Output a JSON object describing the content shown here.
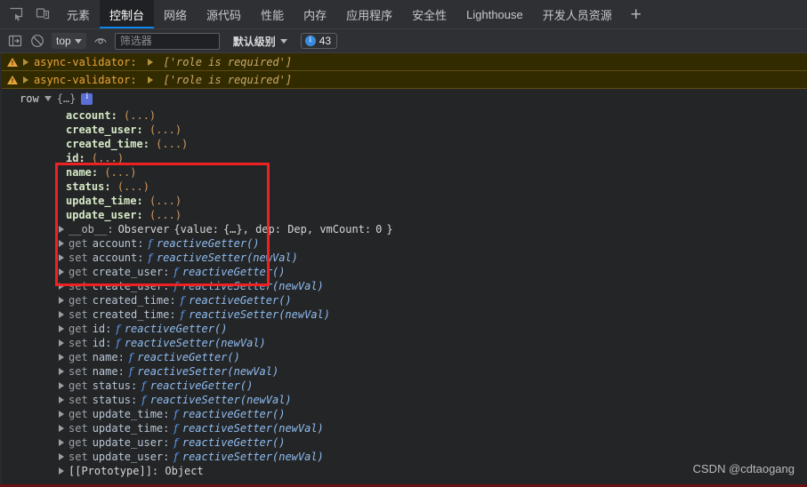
{
  "window": {
    "app": "Chrome DevTools",
    "watermark": "CSDN @cdtaogang"
  },
  "tabbar": {
    "icons": [
      {
        "name": "inspect-element-icon",
        "label": "检查元素"
      },
      {
        "name": "device-toolbar-icon",
        "label": "切换设备工具栏"
      }
    ],
    "tabs": [
      {
        "label": "元素",
        "active": false
      },
      {
        "label": "控制台",
        "active": true
      },
      {
        "label": "网络",
        "active": false
      },
      {
        "label": "源代码",
        "active": false
      },
      {
        "label": "性能",
        "active": false
      },
      {
        "label": "内存",
        "active": false
      },
      {
        "label": "应用程序",
        "active": false
      },
      {
        "label": "安全性",
        "active": false
      },
      {
        "label": "Lighthouse",
        "active": false
      },
      {
        "label": "开发人员资源",
        "active": false
      }
    ],
    "add_label": "+"
  },
  "toolbar": {
    "sidebar_toggle": "console-sidebar-icon",
    "clear_console": "clear-console-icon",
    "context_value": "top",
    "eye_icon": "live-expression-icon",
    "filter_placeholder": "筛选器",
    "filter_value": "",
    "level_label": "默认级别",
    "issues_count": "43"
  },
  "console": {
    "warnings": [
      {
        "source": "async-validator:",
        "value": "['role is required']"
      },
      {
        "source": "async-validator:",
        "value": "['role is required']"
      }
    ],
    "object_row": {
      "label": "row",
      "preview": "{…}",
      "info_icon": "info-badge-icon"
    },
    "properties": [
      {
        "key": "account:",
        "value": "(...)"
      },
      {
        "key": "create_user:",
        "value": "(...)"
      },
      {
        "key": "created_time:",
        "value": "(...)"
      },
      {
        "key": "id:",
        "value": "(...)"
      },
      {
        "key": "name:",
        "value": "(...)"
      },
      {
        "key": "status:",
        "value": "(...)"
      },
      {
        "key": "update_time:",
        "value": "(...)"
      },
      {
        "key": "update_user:",
        "value": "(...)"
      }
    ],
    "observer_line": {
      "key": "__ob__:",
      "class_name": "Observer",
      "body_open": "{value:",
      "body_mid": "{…}, dep: Dep, vmCount:",
      "vm_count": "0",
      "body_close": "}"
    },
    "accessors": [
      {
        "kw": "get",
        "name": "account:",
        "fn": "reactiveGetter()"
      },
      {
        "kw": "set",
        "name": "account:",
        "fn": "reactiveSetter(newVal)"
      },
      {
        "kw": "get",
        "name": "create_user:",
        "fn": "reactiveGetter()"
      },
      {
        "kw": "set",
        "name": "create_user:",
        "fn": "reactiveSetter(newVal)"
      },
      {
        "kw": "get",
        "name": "created_time:",
        "fn": "reactiveGetter()"
      },
      {
        "kw": "set",
        "name": "created_time:",
        "fn": "reactiveSetter(newVal)"
      },
      {
        "kw": "get",
        "name": "id:",
        "fn": "reactiveGetter()"
      },
      {
        "kw": "set",
        "name": "id:",
        "fn": "reactiveSetter(newVal)"
      },
      {
        "kw": "get",
        "name": "name:",
        "fn": "reactiveGetter()"
      },
      {
        "kw": "set",
        "name": "name:",
        "fn": "reactiveSetter(newVal)"
      },
      {
        "kw": "get",
        "name": "status:",
        "fn": "reactiveGetter()"
      },
      {
        "kw": "set",
        "name": "status:",
        "fn": "reactiveSetter(newVal)"
      },
      {
        "kw": "get",
        "name": "update_time:",
        "fn": "reactiveGetter()"
      },
      {
        "kw": "set",
        "name": "update_time:",
        "fn": "reactiveSetter(newVal)"
      },
      {
        "kw": "get",
        "name": "update_user:",
        "fn": "reactiveGetter()"
      },
      {
        "kw": "set",
        "name": "update_user:",
        "fn": "reactiveSetter(newVal)"
      }
    ],
    "prototype_line": "[[Prototype]]: Object"
  },
  "colors": {
    "accent": "#0b87ee",
    "warning_bg": "#332b00",
    "warning_text": "#e8a33d",
    "highlight_box": "#ee2222",
    "property_key": "#d6e9c6",
    "property_value": "#d29a5f"
  }
}
